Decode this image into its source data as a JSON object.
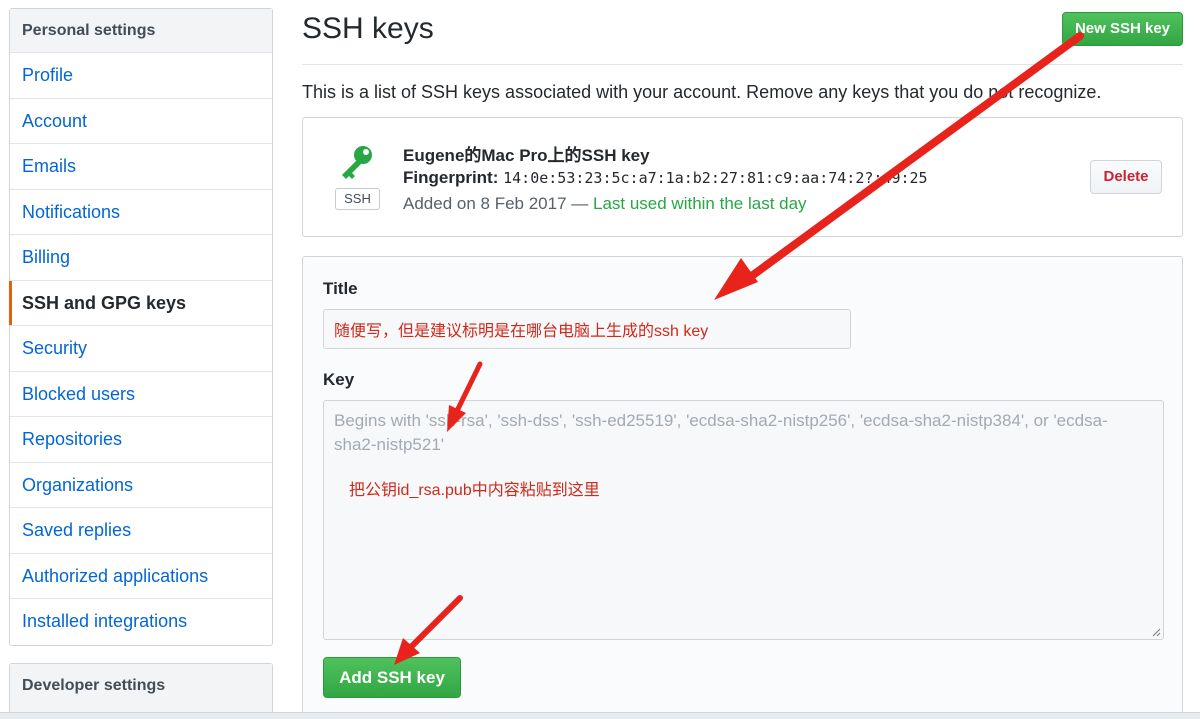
{
  "sidebar": {
    "header": "Personal settings",
    "items": [
      {
        "label": "Profile"
      },
      {
        "label": "Account"
      },
      {
        "label": "Emails"
      },
      {
        "label": "Notifications"
      },
      {
        "label": "Billing"
      },
      {
        "label": "SSH and GPG keys",
        "selected": true
      },
      {
        "label": "Security"
      },
      {
        "label": "Blocked users"
      },
      {
        "label": "Repositories"
      },
      {
        "label": "Organizations"
      },
      {
        "label": "Saved replies"
      },
      {
        "label": "Authorized applications"
      },
      {
        "label": "Installed integrations"
      }
    ],
    "developer_header": "Developer settings"
  },
  "main": {
    "title": "SSH keys",
    "new_key_button": "New SSH key",
    "intro": "This is a list of SSH keys associated with your account. Remove any keys that you do not recognize.",
    "key": {
      "badge": "SSH",
      "icon": "key-icon",
      "name": "Eugene的Mac Pro上的SSH key",
      "fingerprint_label": "Fingerprint:",
      "fingerprint_value": "14:0e:53:23:5c:a7:1a:b2:27:81:c9:aa:74:2?:49:25",
      "added_text": "Added on 8 Feb 2017 —",
      "last_used": "Last used within the last day",
      "delete_button": "Delete"
    },
    "form": {
      "title_label": "Title",
      "title_value": "随便写，但是建议标明是在哪台电脑上生成的ssh key",
      "key_label": "Key",
      "key_placeholder": "Begins with 'ssh-rsa', 'ssh-dss', 'ssh-ed25519', 'ecdsa-sha2-nistp256', 'ecdsa-sha2-nistp384', or 'ecdsa-sha2-nistp521'",
      "key_note": "把公钥id_rsa.pub中内容粘贴到这里",
      "add_button": "Add SSH key"
    }
  },
  "colors": {
    "link": "#0366d6",
    "accent_selected": "#e36209",
    "green_button": "#32a642",
    "delete_red": "#cb2431",
    "annotation_red": "#e8231b",
    "last_used_green": "#28a745"
  }
}
